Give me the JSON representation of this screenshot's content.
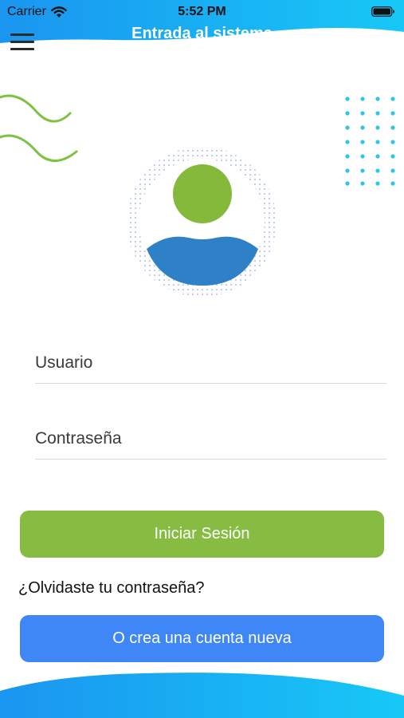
{
  "status_bar": {
    "carrier": "Carrier",
    "time": "5:52 PM",
    "wifi_icon": "wifi-icon",
    "battery_icon": "battery-icon"
  },
  "header": {
    "title": "Entrada al sistema",
    "menu_icon": "hamburger-menu-icon",
    "gradient_colors": [
      "#1a95f0",
      "#17c8f6"
    ]
  },
  "avatar": {
    "icon": "user-avatar-icon",
    "head_color": "#84b93b",
    "body_color": "#2e81c7",
    "ring_color": "#bcc7f2"
  },
  "decorations": {
    "waves_color": "#7dc242",
    "dots_color": "#2cc7e8"
  },
  "form": {
    "username_placeholder": "Usuario",
    "username_value": "",
    "password_placeholder": "Contraseña",
    "password_value": ""
  },
  "buttons": {
    "login_label": "Iniciar Sesión",
    "login_color": "#85bc41",
    "create_account_label": "O crea una cuenta nueva",
    "create_account_color": "#3f86f7"
  },
  "links": {
    "forgot_password": "¿Olvidaste tu contraseña?"
  }
}
